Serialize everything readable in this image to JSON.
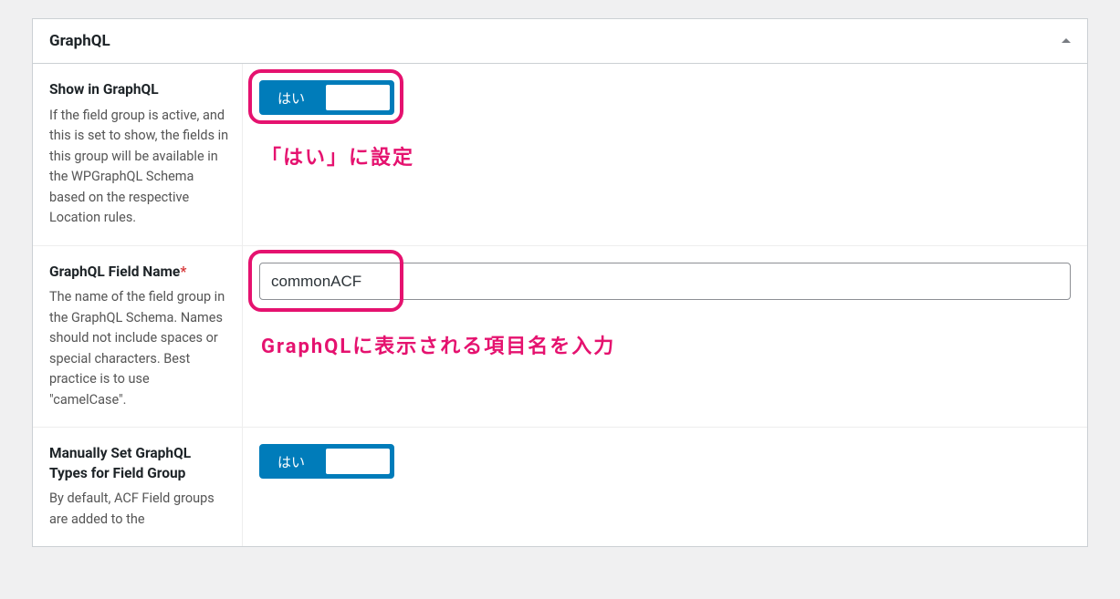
{
  "panel": {
    "title": "GraphQL"
  },
  "fields": [
    {
      "label": "Show in GraphQL",
      "required": false,
      "desc": "If the field group is active, and this is set to show, the fields in this group will be available in the WPGraphQL Schema based on the respective Location rules.",
      "type": "toggle",
      "toggle_label": "はい",
      "toggle_on": true
    },
    {
      "label": "GraphQL Field Name",
      "required": true,
      "required_mark": "*",
      "desc": "The name of the field group in the GraphQL Schema. Names should not include spaces or special characters. Best practice is to use \"camelCase\".",
      "type": "text",
      "value": "commonACF"
    },
    {
      "label": "Manually Set GraphQL Types for Field Group",
      "required": false,
      "desc": "By default, ACF Field groups are added to the",
      "type": "toggle",
      "toggle_label": "はい",
      "toggle_on": true
    }
  ],
  "annotations": {
    "toggle_hint": "「はい」に設定",
    "input_hint": "GraphQLに表示される項目名を入力"
  }
}
